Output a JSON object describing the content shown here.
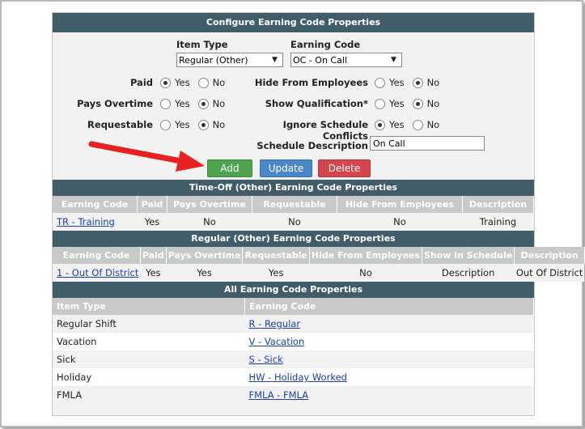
{
  "config": {
    "title": "Configure Earning Code Properties",
    "item_type_label": "Item Type",
    "item_type_value": "Regular (Other)",
    "earning_code_label": "Earning Code",
    "earning_code_value": "OC - On Call",
    "yes": "Yes",
    "no": "No",
    "paid_label": "Paid",
    "pays_overtime_label": "Pays Overtime",
    "requestable_label": "Requestable",
    "hide_label": "Hide From Employees",
    "show_qual_label": "Show Qualification*",
    "ignore_label": "Ignore Schedule Conflicts",
    "sched_desc_label": "Schedule Description",
    "sched_desc_value": "On Call",
    "add_label": "Add",
    "update_label": "Update",
    "delete_label": "Delete"
  },
  "timeoff": {
    "title": "Time-Off (Other) Earning Code Properties",
    "headers": [
      "Earning Code",
      "Paid",
      "Pays Overtime",
      "Requestable",
      "Hide From Employees",
      "Description"
    ],
    "row": {
      "code": "TR - Training",
      "paid": "Yes",
      "ot": "No",
      "req": "No",
      "hide": "No",
      "desc": "Training"
    }
  },
  "regular": {
    "title": "Regular (Other) Earning Code Properties",
    "headers": [
      "Earning Code",
      "Paid",
      "Pays Overtime",
      "Requestable",
      "Hide From Employees",
      "Show in Schedule",
      "Description"
    ],
    "row": {
      "code": "1 - Out Of District",
      "paid": "Yes",
      "ot": "Yes",
      "req": "Yes",
      "hide": "No",
      "show": "Description",
      "desc": "Out Of District"
    }
  },
  "all": {
    "title": "All Earning Code Properties",
    "headers": [
      "Item Type",
      "Earning Code"
    ],
    "rows": [
      {
        "type": "Regular Shift",
        "code": "R - Regular"
      },
      {
        "type": "Vacation",
        "code": "V - Vacation"
      },
      {
        "type": "Sick",
        "code": "S - Sick"
      },
      {
        "type": "Holiday",
        "code": "HW - Holiday Worked"
      },
      {
        "type": "FMLA",
        "code": "FMLA - FMLA"
      }
    ]
  },
  "colors": {
    "header": "#425d6a",
    "add": "#4ea44e",
    "update": "#4a87c8",
    "delete": "#d5454d",
    "arrow": "#e8211f"
  }
}
